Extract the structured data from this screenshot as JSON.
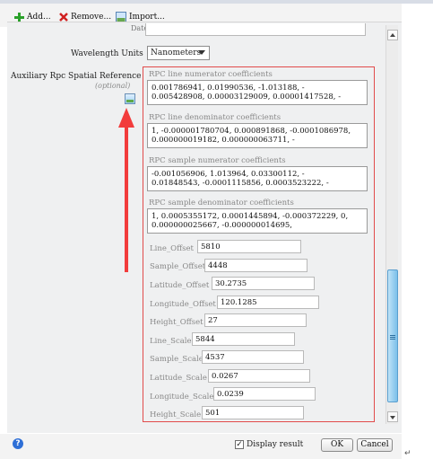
{
  "toolbar": {
    "add_label": "Add...",
    "remove_label": "Remove...",
    "import_label": "Import..."
  },
  "form": {
    "prev_field_label": "Date:",
    "wavelength_label": "Wavelength Units",
    "wavelength_value": "Nanometers",
    "aux_label": "Auxiliary Rpc Spatial Reference",
    "aux_sublabel": "(optional)"
  },
  "rpc": {
    "line_num_title": "RPC line numerator coefficients",
    "line_num_text": "0.001786941, 0.01990536, -1.013188, -\n0.005428908, 0.00003129009, 0.00001417528, -",
    "line_den_title": "RPC line denominator coefficients",
    "line_den_text": "1, -0.000001780704, 0.000891868, -0.0001086978,\n0.000000019182, 0.000000063711, -",
    "samp_num_title": "RPC sample numerator coefficients",
    "samp_num_text": "-0.001056906, 1.013964, 0.03300112, -\n0.01848543, -0.0001115856, 0.0003523222, -",
    "samp_den_title": "RPC sample denominator coefficients",
    "samp_den_text": "1, 0.0005355172, 0.0001445894, -0.000372229, 0,\n0.000000025667, -0.000000014695,",
    "params": [
      {
        "label": "Line_Offset",
        "value": "5810"
      },
      {
        "label": "Sample_Offset",
        "value": "4448"
      },
      {
        "label": "Latitude_Offset",
        "value": "30.2735"
      },
      {
        "label": "Longitude_Offset",
        "value": "120.1285"
      },
      {
        "label": "Height_Offset",
        "value": "27"
      },
      {
        "label": "Line_Scale",
        "value": "5844"
      },
      {
        "label": "Sample_Scale",
        "value": "4537"
      },
      {
        "label": "Latitude_Scale",
        "value": "0.0267"
      },
      {
        "label": "Longitude_Scale",
        "value": "0.0239"
      },
      {
        "label": "Height_Scale",
        "value": "501"
      }
    ]
  },
  "footer": {
    "display_result_label": "Display result",
    "display_result_checked": true,
    "ok_label": "OK",
    "cancel_label": "Cancel",
    "help_glyph": "?"
  },
  "colors": {
    "annotation_red": "#e14b4b",
    "scroll_thumb": "#7cc0ea"
  },
  "icons": [
    "add-icon",
    "remove-icon",
    "import-icon",
    "image-icon",
    "help-icon"
  ]
}
